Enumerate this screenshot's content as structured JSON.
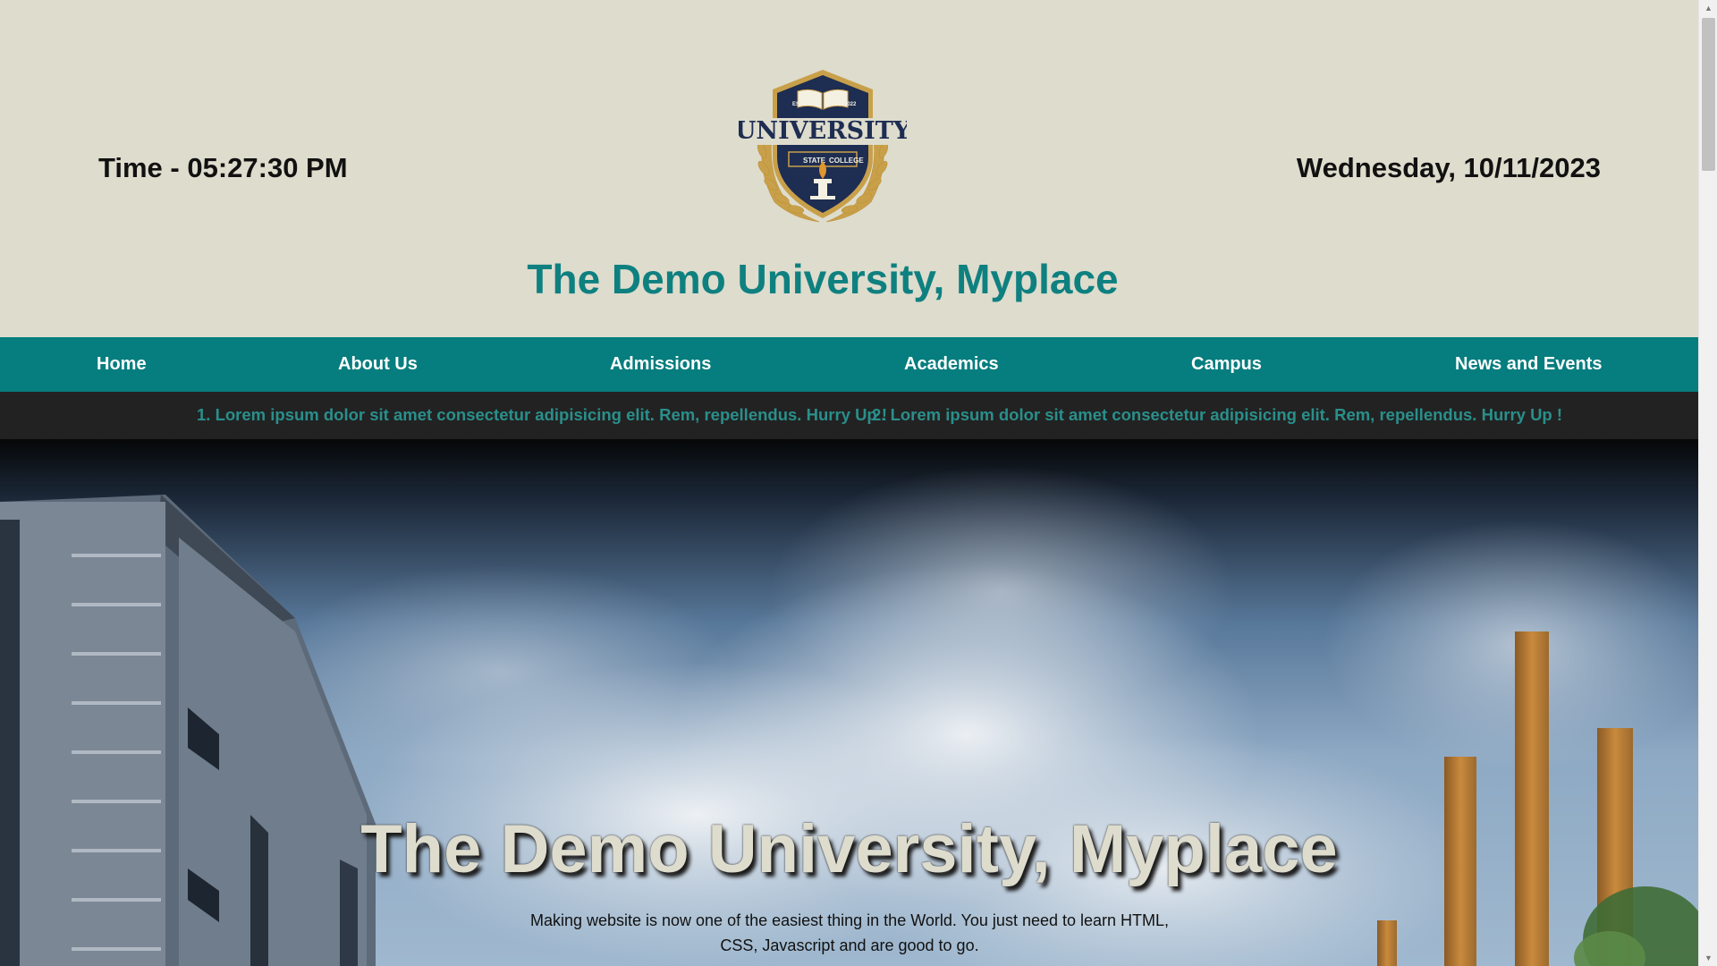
{
  "header": {
    "time_text": "Time - 05:27:30 PM",
    "date_text": "Wednesday, 10/11/2023",
    "site_title": "The Demo University, Myplace",
    "logo": {
      "main_text": "UNIVERSITY",
      "left_text": "ESTD.",
      "right_text": "2022",
      "banner_left": "STATE",
      "banner_right": "COLLEGE"
    }
  },
  "nav": {
    "items": [
      {
        "label": "Home"
      },
      {
        "label": "About Us"
      },
      {
        "label": "Admissions"
      },
      {
        "label": "Academics"
      },
      {
        "label": "Campus"
      },
      {
        "label": "News and Events"
      }
    ]
  },
  "ticker": {
    "items": [
      {
        "text": "1. Lorem ipsum dolor sit amet consectetur adipisicing elit. Rem, repellendus. Hurry Up !"
      },
      {
        "text": "2. Lorem ipsum dolor sit amet consectetur adipisicing elit. Rem, repellendus. Hurry Up !"
      }
    ]
  },
  "hero": {
    "title": "The Demo University, Myplace",
    "description": "Making website is now one of the easiest thing in the World. You just need to learn HTML, CSS, Javascript and are good to go."
  },
  "colors": {
    "header_bg": "#dedccd",
    "accent_teal": "#067d7e",
    "title_teal": "#0f8080",
    "ticker_bg": "#222222",
    "ticker_text": "#2a8f8b"
  }
}
